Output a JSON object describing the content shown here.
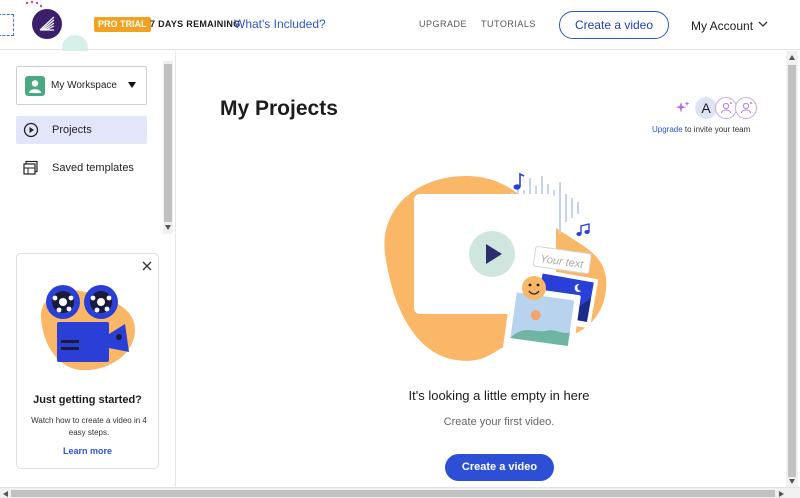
{
  "topbar": {
    "badge": "PRO TRIAL",
    "days_remaining": "7 DAYS REMAINING",
    "whats_included": "What's Included?",
    "nav_upgrade": "UPGRADE",
    "nav_tutorials": "TUTORIALS",
    "create_button": "Create a video",
    "account": "My Account"
  },
  "sidebar": {
    "workspace": "My Workspace",
    "items": [
      {
        "label": "Projects",
        "icon": "play-circle-icon",
        "active": true
      },
      {
        "label": "Saved templates",
        "icon": "templates-icon",
        "active": false
      }
    ],
    "card": {
      "title": "Just getting started?",
      "description": "Watch how to create a video in 4 easy steps.",
      "link": "Learn more"
    }
  },
  "main": {
    "title": "My Projects",
    "team": {
      "avatar_letter": "A",
      "invite_link": "Upgrade",
      "invite_text": " to invite your team"
    },
    "illustration_text": "Your text",
    "empty_title": "It's looking a little empty in here",
    "empty_subtitle": "Create your first video.",
    "create_button": "Create a video"
  },
  "colors": {
    "accent": "#2d4fd6",
    "link": "#2d56d1",
    "badge": "#f2a221",
    "active_item": "#e1e6fa",
    "illustration_orange": "#f9b767"
  }
}
